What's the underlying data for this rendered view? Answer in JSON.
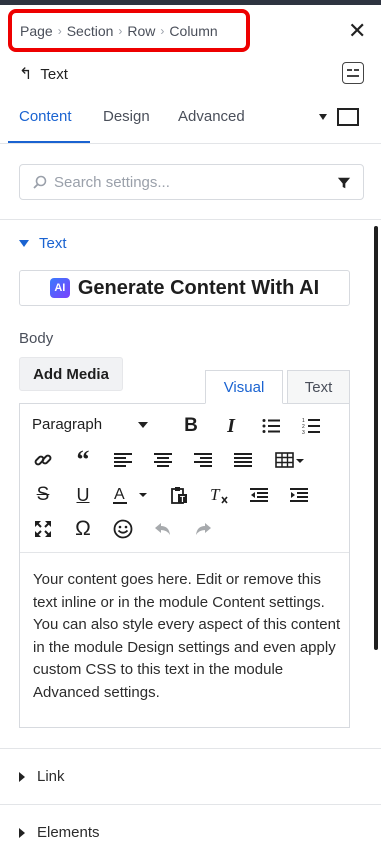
{
  "breadcrumb": {
    "items": [
      "Page",
      "Section",
      "Row",
      "Column"
    ],
    "separator": "›",
    "highlight_color": "#ee0000"
  },
  "header": {
    "back_label": "Text",
    "back_icon": "↰",
    "close_icon": "✕"
  },
  "tabs": {
    "items": [
      {
        "label": "Content",
        "active": true
      },
      {
        "label": "Design",
        "active": false
      },
      {
        "label": "Advanced",
        "active": false
      }
    ],
    "accent_color": "#1a63d1"
  },
  "search": {
    "placeholder": "Search settings...",
    "value": ""
  },
  "section": {
    "title": "Text",
    "ai_button_label": "Generate Content With AI",
    "ai_logo_text": "AI"
  },
  "body_field": {
    "label": "Body",
    "add_media_label": "Add Media",
    "editor_tabs": [
      {
        "label": "Visual",
        "active": true
      },
      {
        "label": "Text",
        "active": false
      }
    ],
    "format_select": "Paragraph",
    "toolbar_icons": [
      "bold-icon",
      "italic-icon",
      "bullet-list-icon",
      "numbered-list-icon",
      "link-icon",
      "blockquote-icon",
      "align-left-icon",
      "align-center-icon",
      "align-right-icon",
      "align-justify-icon",
      "table-icon",
      "strikethrough-icon",
      "underline-icon",
      "text-color-icon",
      "paste-text-icon",
      "clear-format-icon",
      "outdent-icon",
      "indent-icon",
      "fullscreen-icon",
      "special-char-icon",
      "emoji-icon",
      "undo-icon",
      "redo-icon"
    ],
    "content_text": "Your content goes here. Edit or remove this text inline or in the module Content settings. You can also style every aspect of this content in the module Design settings and even apply custom CSS to this text in the module Advanced settings."
  },
  "collapsed_sections": [
    {
      "label": "Link"
    },
    {
      "label": "Elements"
    }
  ]
}
